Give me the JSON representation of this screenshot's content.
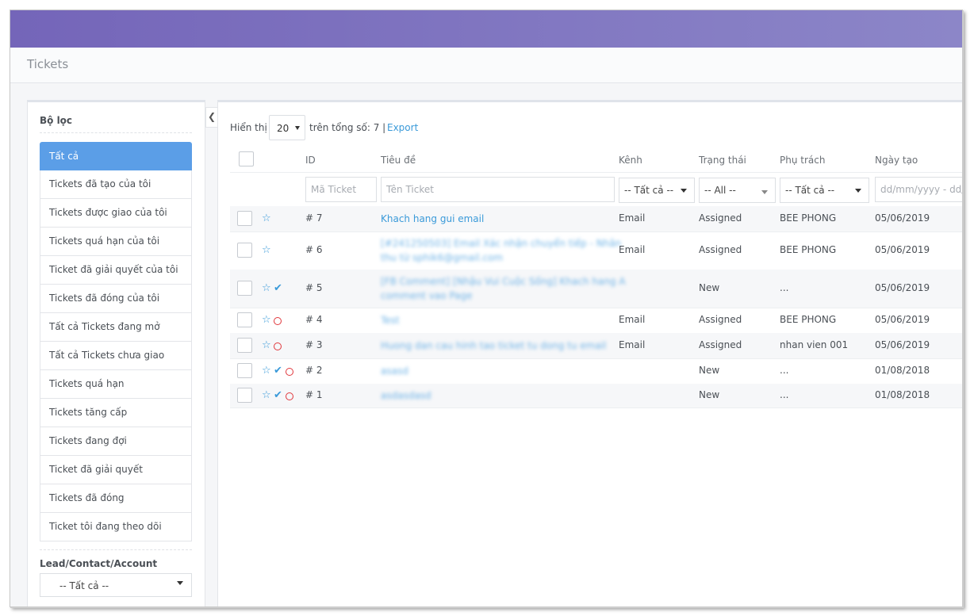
{
  "page": {
    "title": "Tickets"
  },
  "sidebar": {
    "title": "Bộ lọc",
    "items": [
      {
        "label": "Tất cả",
        "active": true
      },
      {
        "label": "Tickets đã tạo của tôi"
      },
      {
        "label": "Tickets được giao của tôi"
      },
      {
        "label": "Tickets quá hạn của tôi"
      },
      {
        "label": "Ticket đã giải quyết của tôi"
      },
      {
        "label": "Tickets đã đóng của tôi"
      },
      {
        "label": "Tất cả Tickets đang mở"
      },
      {
        "label": "Tất cả Tickets chưa giao"
      },
      {
        "label": "Tickets quá hạn"
      },
      {
        "label": "Tickets tăng cấp"
      },
      {
        "label": "Tickets đang đợi"
      },
      {
        "label": "Ticket đã giải quyết"
      },
      {
        "label": "Tickets đã đóng"
      },
      {
        "label": "Ticket tôi đang theo dõi"
      }
    ],
    "lead_label": "Lead/Contact/Account",
    "lead_select": "-- Tất cả --"
  },
  "toolbar": {
    "show_label": "Hiển thị",
    "page_size": "20",
    "total_text": "trên tổng số: 7 |",
    "export_label": "Export"
  },
  "table": {
    "headers": {
      "id": "ID",
      "title": "Tiêu đề",
      "channel": "Kênh",
      "status": "Trạng thái",
      "owner": "Phụ trách",
      "created": "Ngày tạo"
    },
    "filters": {
      "id_placeholder": "Mã Ticket",
      "title_placeholder": "Tên Ticket",
      "channel": "-- Tất cả --",
      "status": "-- All --",
      "owner": "-- Tất cả --",
      "date_placeholder": "dd/mm/yyyy - dd/m"
    },
    "rows": [
      {
        "id": "# 7",
        "title": "Khach hang gui email",
        "title_blurred": false,
        "channel": "Email",
        "status": "Assigned",
        "owner": "BEE PHONG",
        "created": "05/06/2019",
        "icons": [
          "star-icon"
        ]
      },
      {
        "id": "# 6",
        "title": "[#241250503] Email Xác nhận chuyển tiếp - Nhân\nthu từ sphik6@gmail.com",
        "title_blurred": true,
        "channel": "Email",
        "status": "Assigned",
        "owner": "BEE PHONG",
        "created": "05/06/2019",
        "icons": [
          "star-icon"
        ]
      },
      {
        "id": "# 5",
        "title": "[FB Comment] [Nhậu Vui Cuộc Sống] Khach hang A\ncomment vao Page",
        "title_blurred": true,
        "channel": "",
        "status": "New",
        "owner": "...",
        "created": "05/06/2019",
        "icons": [
          "star-icon",
          "check-icon"
        ]
      },
      {
        "id": "# 4",
        "title": "Test",
        "title_blurred": true,
        "channel": "Email",
        "status": "Assigned",
        "owner": "BEE PHONG",
        "created": "05/06/2019",
        "icons": [
          "star-icon",
          "circle-icon"
        ]
      },
      {
        "id": "# 3",
        "title": "Huong dan cau hinh tao ticket tu dong tu email",
        "title_blurred": true,
        "channel": "Email",
        "status": "Assigned",
        "owner": "nhan vien 001",
        "created": "05/06/2019",
        "icons": [
          "star-icon",
          "circle-icon"
        ]
      },
      {
        "id": "# 2",
        "title": "asasd",
        "title_blurred": true,
        "channel": "",
        "status": "New",
        "owner": "...",
        "created": "01/08/2018",
        "icons": [
          "star-icon",
          "check-icon",
          "circle-icon"
        ]
      },
      {
        "id": "# 1",
        "title": "asdasdasd",
        "title_blurred": true,
        "channel": "",
        "status": "New",
        "owner": "...",
        "created": "01/08/2018",
        "icons": [
          "star-icon",
          "check-icon",
          "circle-icon"
        ]
      }
    ]
  },
  "colors": {
    "header_gradient_start": "#7465b9",
    "header_gradient_end": "#8c86c8",
    "active_filter": "#5b9ee7",
    "link": "#3a9ad9",
    "circle_icon": "#e0373c"
  }
}
